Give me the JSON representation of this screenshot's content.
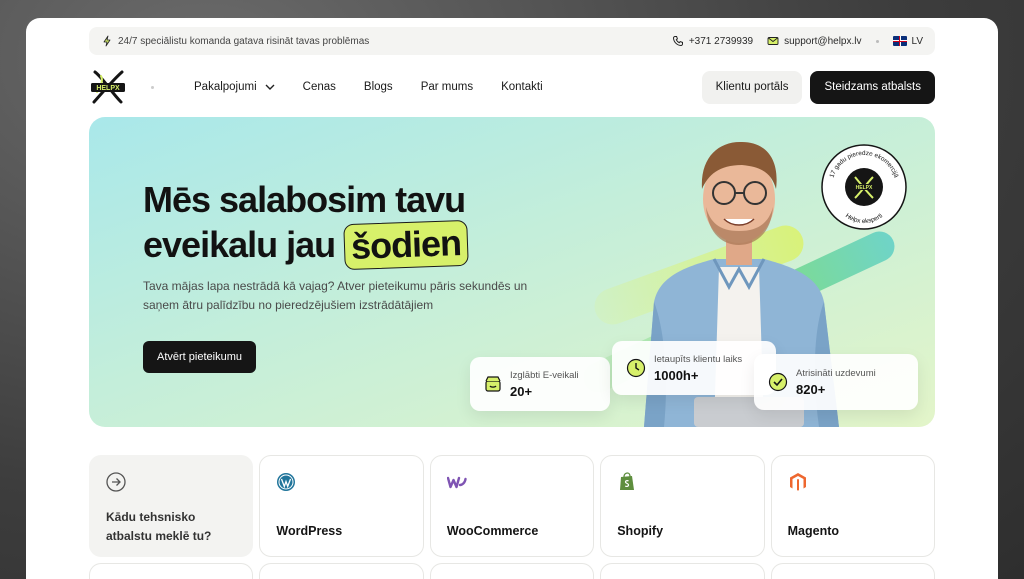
{
  "topbar": {
    "tagline": "24/7 speciālistu komanda gatava risināt tavas problēmas",
    "phone": "+371 2739939",
    "email": "support@helpx.lv",
    "language": "LV"
  },
  "logo": {
    "text": "HELPX"
  },
  "nav": {
    "items": [
      "Pakalpojumi",
      "Cenas",
      "Blogs",
      "Par mums",
      "Kontakti"
    ],
    "client_portal": "Klientu portāls",
    "urgent_support": "Steidzams atbalsts"
  },
  "hero": {
    "title_line1": "Mēs salabosim tavu",
    "title_line2": "eveikalu jau",
    "title_highlight": "šodien",
    "description": "Tava mājas lapa nestrādā kā vajag? Atver pieteikumu pāris sekundēs un saņem ātru palīdzību no pieredzējušiem izstrādātājiem",
    "cta": "Atvērt pieteikumu",
    "badge_top": "17 gadu pieredze ekomercijā",
    "badge_bottom": "Helpx eksperti",
    "stats": [
      {
        "label": "Izglābti E-veikali",
        "value": "20+"
      },
      {
        "label": "Ietaupīts klientu laiks",
        "value": "1000h+"
      },
      {
        "label": "Atrisināti uzdevumi",
        "value": "820+"
      }
    ]
  },
  "platforms": {
    "question": "Kādu tehsnisko atbalstu meklē tu?",
    "items": [
      {
        "name": "WordPress",
        "icon": "wordpress-icon",
        "color": "#21759b"
      },
      {
        "name": "WooCommerce",
        "icon": "woocommerce-icon",
        "color": "#7f54b3"
      },
      {
        "name": "Shopify",
        "icon": "shopify-icon",
        "color": "#5e8e3e"
      },
      {
        "name": "Magento",
        "icon": "magento-icon",
        "color": "#ee672f"
      }
    ]
  },
  "colors": {
    "accent": "#d7f06a",
    "dark": "#151515"
  }
}
